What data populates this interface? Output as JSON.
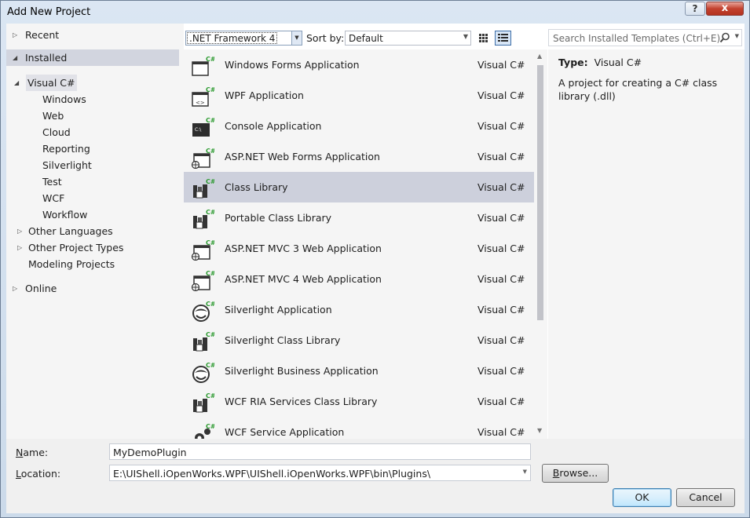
{
  "window": {
    "title": "Add New Project",
    "help_label": "?",
    "close_label": "x"
  },
  "tree": {
    "recent": "Recent",
    "installed": "Installed",
    "visual_csharp": "Visual C#",
    "children": [
      "Windows",
      "Web",
      "Cloud",
      "Reporting",
      "Silverlight",
      "Test",
      "WCF",
      "Workflow"
    ],
    "other_languages": "Other Languages",
    "other_project_types": "Other Project Types",
    "modeling_projects": "Modeling Projects",
    "online": "Online"
  },
  "toolbar": {
    "framework": ".NET Framework 4",
    "sort_by_label": "Sort by:",
    "sort_value": "Default",
    "search_placeholder": "Search Installed Templates (Ctrl+E)"
  },
  "templates": [
    {
      "name": "Windows Forms Application",
      "lang": "Visual C#",
      "icon": "windows-forms-icon"
    },
    {
      "name": "WPF Application",
      "lang": "Visual C#",
      "icon": "wpf-icon"
    },
    {
      "name": "Console Application",
      "lang": "Visual C#",
      "icon": "console-icon"
    },
    {
      "name": "ASP.NET Web Forms Application",
      "lang": "Visual C#",
      "icon": "web-forms-icon"
    },
    {
      "name": "Class Library",
      "lang": "Visual C#",
      "icon": "class-library-icon"
    },
    {
      "name": "Portable Class Library",
      "lang": "Visual C#",
      "icon": "portable-library-icon"
    },
    {
      "name": "ASP.NET MVC 3 Web Application",
      "lang": "Visual C#",
      "icon": "mvc-icon"
    },
    {
      "name": "ASP.NET MVC 4 Web Application",
      "lang": "Visual C#",
      "icon": "mvc-icon"
    },
    {
      "name": "Silverlight Application",
      "lang": "Visual C#",
      "icon": "silverlight-icon"
    },
    {
      "name": "Silverlight Class Library",
      "lang": "Visual C#",
      "icon": "silverlight-library-icon"
    },
    {
      "name": "Silverlight Business Application",
      "lang": "Visual C#",
      "icon": "silverlight-icon"
    },
    {
      "name": "WCF RIA Services Class Library",
      "lang": "Visual C#",
      "icon": "ria-library-icon"
    },
    {
      "name": "WCF Service Application",
      "lang": "Visual C#",
      "icon": "wcf-service-icon"
    }
  ],
  "details": {
    "type_label": "Type:",
    "type_value": "Visual C#",
    "description": "A project for creating a C# class library (.dll)"
  },
  "form": {
    "name_label": "Name:",
    "name_value": "MyDemoPlugin",
    "location_label": "Location:",
    "location_value": "E:\\UIShell.iOpenWorks.WPF\\UIShell.iOpenWorks.WPF\\bin\\Plugins\\",
    "browse_label": "Browse...",
    "ok_label": "OK",
    "cancel_label": "Cancel"
  },
  "colors": {
    "selection": "#cdd0dc",
    "csharp_badge": "#2b9a2f"
  }
}
